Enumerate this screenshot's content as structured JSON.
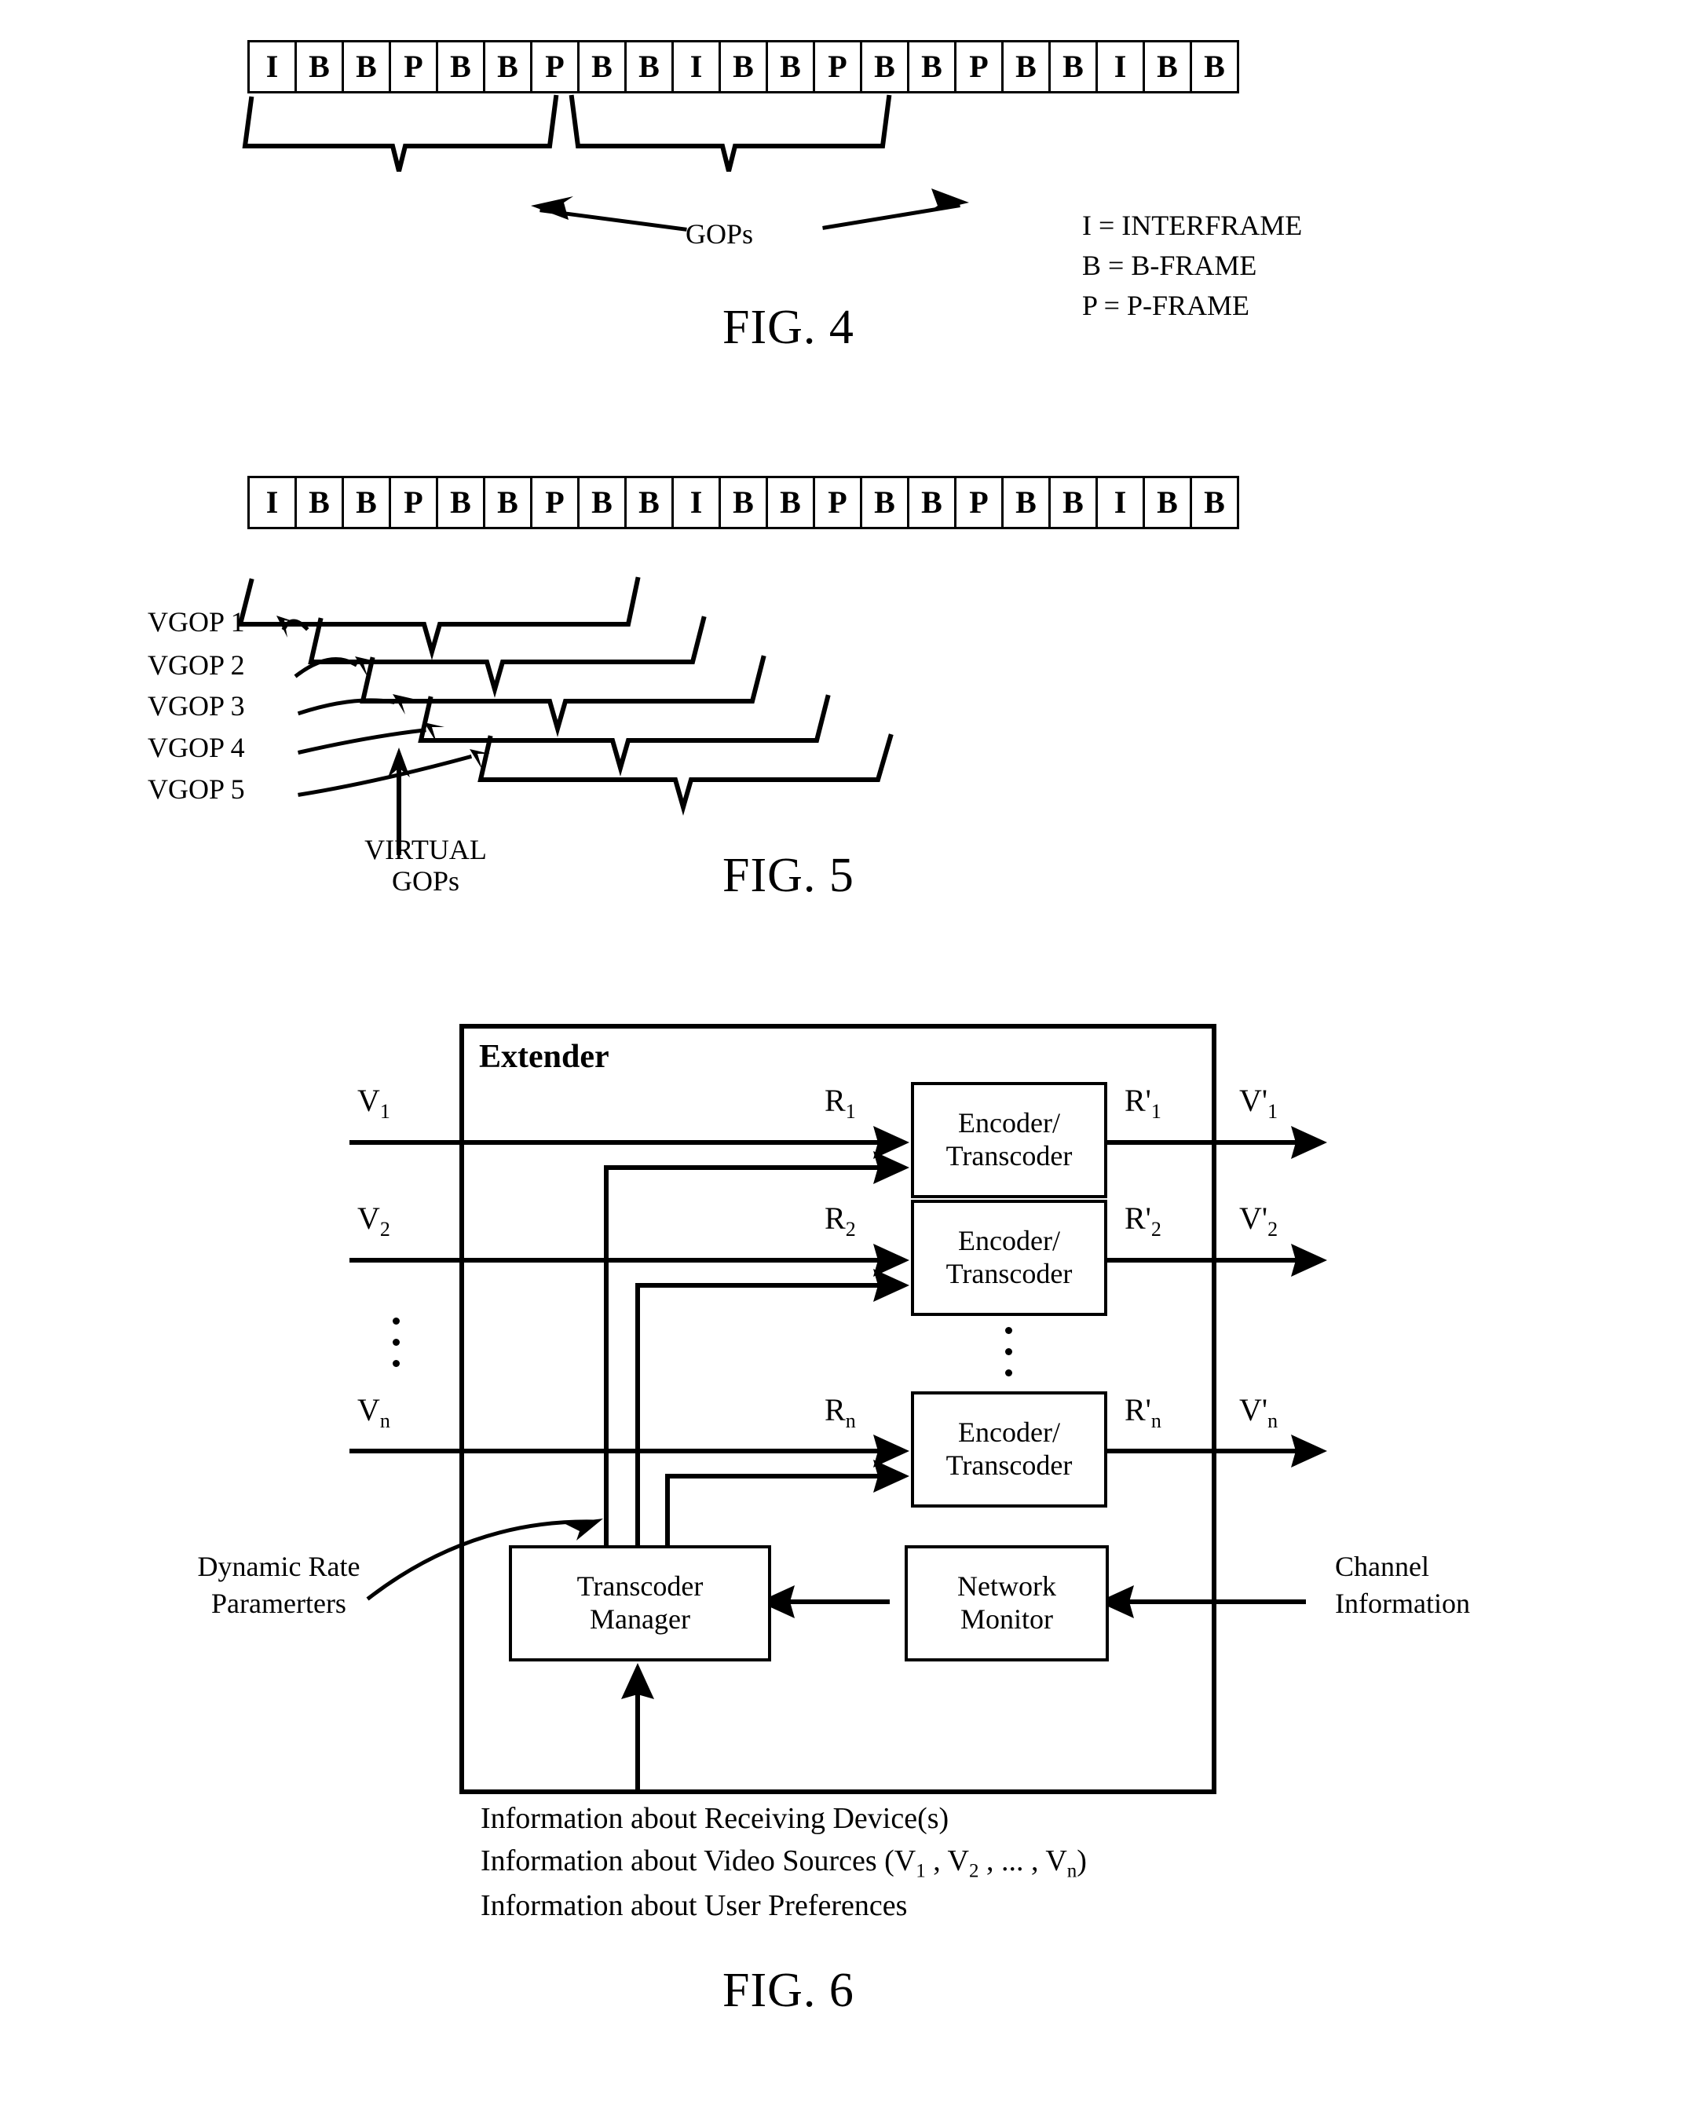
{
  "figures": {
    "fig4": {
      "caption": "FIG. 4",
      "frames": [
        "I",
        "B",
        "B",
        "P",
        "B",
        "B",
        "P",
        "B",
        "B",
        "I",
        "B",
        "B",
        "P",
        "B",
        "B",
        "P",
        "B",
        "B",
        "I",
        "B",
        "B"
      ],
      "brace_label": "GOPs",
      "legend": [
        "I = INTERFRAME",
        "B = B-FRAME",
        "P = P-FRAME"
      ]
    },
    "fig5": {
      "caption": "FIG. 5",
      "frames": [
        "I",
        "B",
        "B",
        "P",
        "B",
        "B",
        "P",
        "B",
        "B",
        "I",
        "B",
        "B",
        "P",
        "B",
        "B",
        "P",
        "B",
        "B",
        "I",
        "B",
        "B"
      ],
      "vgop_labels": [
        "VGOP 1",
        "VGOP 2",
        "VGOP 3",
        "VGOP 4",
        "VGOP 5"
      ],
      "virtual_label_line1": "VIRTUAL",
      "virtual_label_line2": "GOPs"
    },
    "fig6": {
      "caption": "FIG. 6",
      "extender_title": "Extender",
      "encoder_rows": [
        {
          "box_line1": "Encoder/",
          "box_line2": "Transcoder",
          "in_video": "V",
          "in_video_sub": "1",
          "in_rate": "R",
          "in_rate_sub": "1",
          "out_rate": "R'",
          "out_rate_sub": "1",
          "out_video": "V'",
          "out_video_sub": "1"
        },
        {
          "box_line1": "Encoder/",
          "box_line2": "Transcoder",
          "in_video": "V",
          "in_video_sub": "2",
          "in_rate": "R",
          "in_rate_sub": "2",
          "out_rate": "R'",
          "out_rate_sub": "2",
          "out_video": "V'",
          "out_video_sub": "2"
        },
        {
          "box_line1": "Encoder/",
          "box_line2": "Transcoder",
          "in_video": "V",
          "in_video_sub": "n",
          "in_rate": "R",
          "in_rate_sub": "n",
          "out_rate": "R'",
          "out_rate_sub": "n",
          "out_video": "V'",
          "out_video_sub": "n"
        }
      ],
      "transcoder_manager": {
        "line1": "Transcoder",
        "line2": "Manager"
      },
      "network_monitor": {
        "line1": "Network",
        "line2": "Monitor"
      },
      "dynamic_rate": {
        "line1": "Dynamic Rate",
        "line2": "Paramerters"
      },
      "channel_information": {
        "line1": "Channel",
        "line2": "Information"
      },
      "info_lines": [
        "Information about Receiving Device(s)",
        "Information about Video Sources (V1 , V2 , ... , Vn)",
        "Information about User Preferences"
      ]
    }
  },
  "colors": {
    "ink": "#000000",
    "paper": "#ffffff"
  }
}
